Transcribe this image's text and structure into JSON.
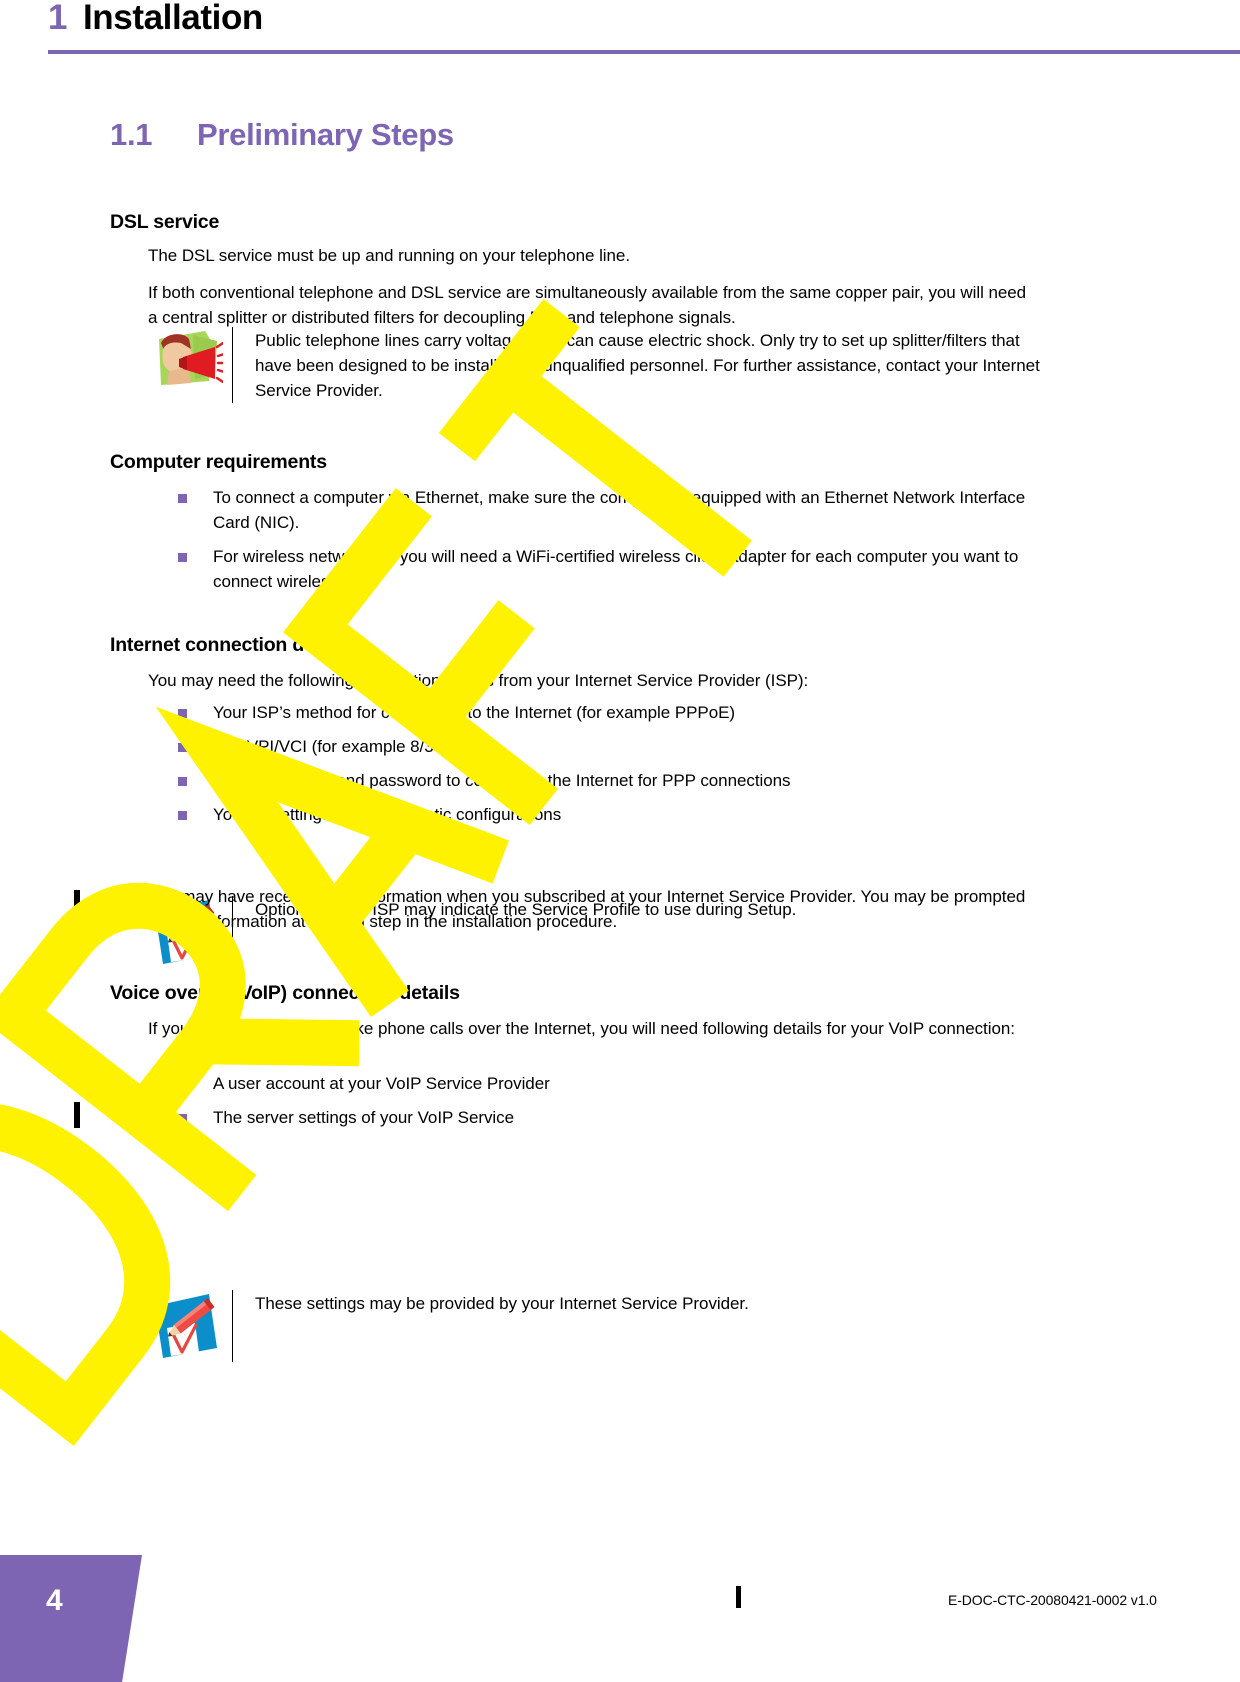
{
  "chapter": {
    "number": "1",
    "title": "Installation"
  },
  "section": {
    "number": "1.1",
    "title": "Preliminary Steps"
  },
  "dsl_service": {
    "heading": "DSL service",
    "para1": "The DSL service must be up and running on your telephone line.",
    "para2": "If both conventional telephone and DSL service are simultaneously available from the same copper pair, you will need a central splitter or distributed filters for decoupling DSL and telephone signals.",
    "warning": {
      "icon": "warning-megaphone-icon",
      "text": "Public telephone lines carry voltages that can cause electric shock. Only try to set up splitter/filters that have been designed to be installed by unqualified personnel. For further assistance, contact your Internet Service Provider."
    }
  },
  "computer_requirements": {
    "heading": "Computer requirements",
    "items": [
      "To connect a computer via Ethernet, make sure the computer is equipped with an Ethernet Network Interface Card (NIC).",
      "For wireless networking, you will need a WiFi-certified wireless client adapter for each computer you want to connect wirelessly."
    ]
  },
  "internet_connection": {
    "heading": "Internet connection details",
    "intro": "You may need the following connection details from your Internet Service Provider (ISP):",
    "items": [
      "Your ISP’s method for connecting to the Internet (for example PPPoE)",
      "The VPI/VCI (for example 8/35)",
      "Your user name and password to connect to the Internet for PPP connections",
      "Your IP settings in case of static configurations"
    ],
    "note": {
      "icon": "note-pencil-icon",
      "text": "Optionally your ISP may indicate the Service Profile to use during Setup."
    },
    "outro": "You may have received this information when you subscribed at your Internet Service Provider. You may be prompted for this information at a given step in the installation procedure."
  },
  "voip_connection": {
    "heading": "Voice over IP (VoIP) connection details",
    "intro": "If you want to be able to make phone calls over the Internet, you will need following details for your VoIP connection:",
    "items": [
      "A user account at your VoIP Service Provider",
      "The server settings of your VoIP Service"
    ],
    "note": {
      "icon": "note-pencil-icon",
      "text": "These settings may be provided by your Internet Service Provider."
    }
  },
  "watermark": {
    "text": "DRAFT",
    "color": "#FFF200"
  },
  "footer": {
    "page_number": "4",
    "document_id": "E-DOC-CTC-20080421-0002 v1.0"
  },
  "colors": {
    "accent_purple": "#7D65B4",
    "bullet_purple": "#7D65B4",
    "note_blue": "#0C8ECB",
    "pencil_red": "#E8473F",
    "warning_green": "#A8D65A"
  }
}
